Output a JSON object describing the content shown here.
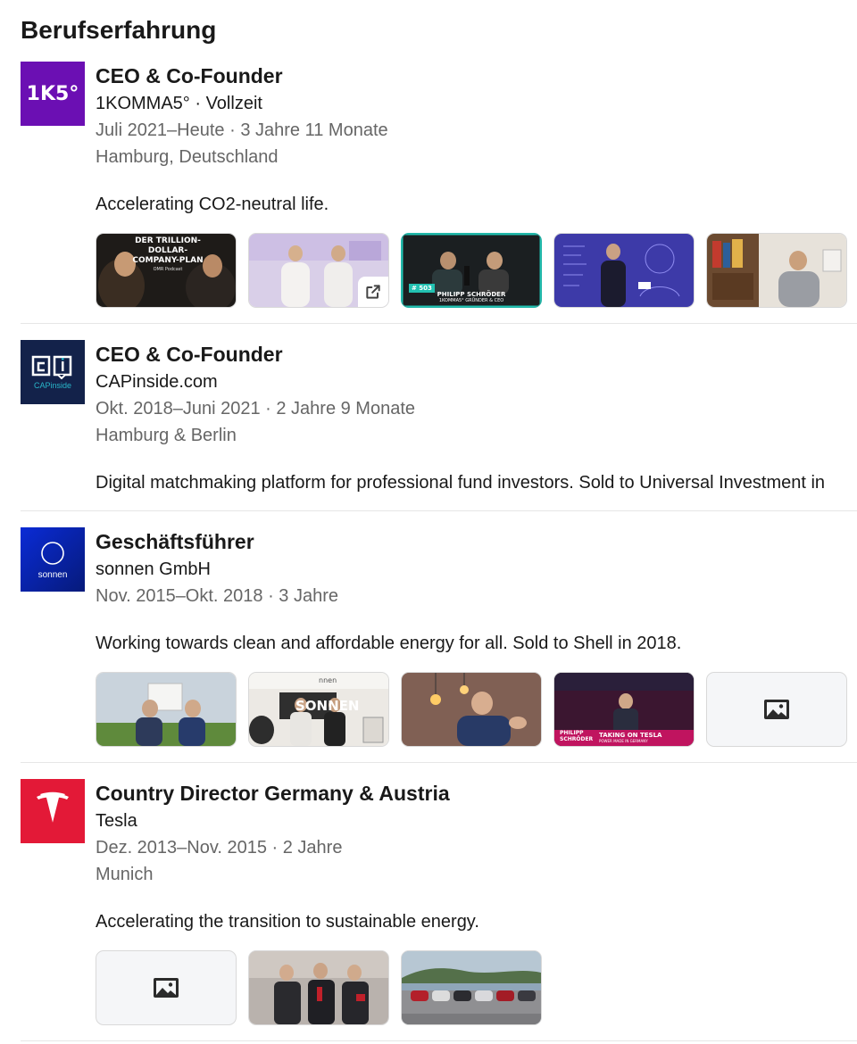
{
  "section": {
    "title": "Berufserfahrung"
  },
  "experiences": [
    {
      "role": "CEO & Co-Founder",
      "company": "1KOMMA5° · Vollzeit",
      "period": "Juli 2021–Heute · 3 Jahre 11 Monate",
      "location": "Hamburg, Deutschland",
      "description": "Accelerating CO2-neutral life.",
      "logo": {
        "icon": "1komma5-logo",
        "text": "1K5°",
        "bg": "#6b0fb3"
      },
      "media": [
        {
          "icon": "podcast-thumbnail",
          "text_lines": [
            "DER TRILLION-",
            "DOLLAR-",
            "COMPANY-PLAN"
          ],
          "caption": "OMR Podcast"
        },
        {
          "icon": "founders-photo-thumbnail",
          "external_link_icon": "external-link-icon"
        },
        {
          "icon": "podcast-thumbnail",
          "badge": "# 503",
          "caption": "PHILIPP SCHRÖDER",
          "subcaption": "1KOMMA5° GRÜNDER & CEO"
        },
        {
          "icon": "conference-photo-thumbnail"
        },
        {
          "icon": "interview-photo-thumbnail"
        }
      ]
    },
    {
      "role": "CEO & Co-Founder",
      "company": "CAPinside.com",
      "period": "Okt. 2018–Juni 2021 · 2 Jahre 9 Monate",
      "location": "Hamburg & Berlin",
      "description": "Digital matchmaking platform for professional fund investors. Sold to Universal Investment in",
      "logo": {
        "icon": "capinside-logo",
        "text": "CAPinside",
        "bg": "#13224a",
        "accent": "#29b6c9"
      }
    },
    {
      "role": "Geschäftsführer",
      "company": "sonnen GmbH",
      "period": "Nov. 2015–Okt. 2018 · 3 Jahre",
      "location": "",
      "description": "Working towards clean and affordable energy for all. Sold to Shell in 2018.",
      "logo": {
        "icon": "sonnen-logo",
        "text": "sonnen",
        "bg": "#0a2bd6"
      },
      "media": [
        {
          "icon": "outdoor-photo-thumbnail"
        },
        {
          "icon": "sonnen-store-photo-thumbnail",
          "text": "SONNEN",
          "caption": "nnen"
        },
        {
          "icon": "interview-photo-thumbnail"
        },
        {
          "icon": "stage-talk-thumbnail",
          "caption": "PHILIPP SCHRÖDER",
          "subcaption": "TAKING ON TESLA",
          "subcaption2": "POWER MADE IN GERMANY"
        },
        {
          "icon": "image-placeholder-icon"
        }
      ]
    },
    {
      "role": "Country Director Germany & Austria",
      "company": "Tesla",
      "period": "Dez. 2013–Nov. 2015 · 2 Jahre",
      "location": "Munich",
      "description": "Accelerating the transition to sustainable energy.",
      "logo": {
        "icon": "tesla-logo",
        "bg": "#e31937"
      },
      "media": [
        {
          "icon": "image-placeholder-icon"
        },
        {
          "icon": "award-photo-thumbnail"
        },
        {
          "icon": "cars-photo-thumbnail"
        }
      ]
    }
  ]
}
